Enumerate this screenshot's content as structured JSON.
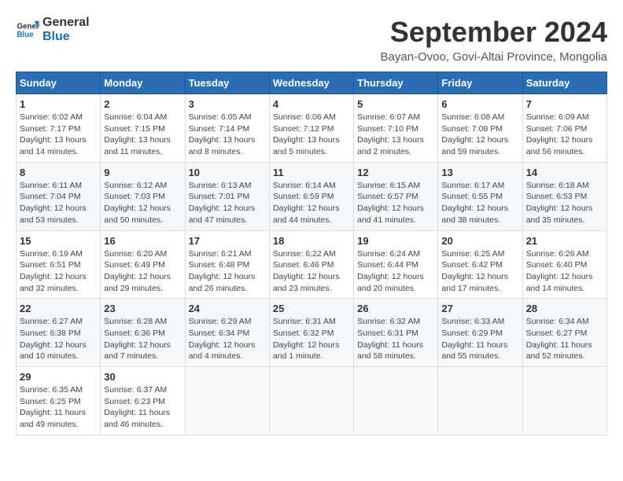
{
  "logo": {
    "line1": "General",
    "line2": "Blue"
  },
  "title": "September 2024",
  "subtitle": "Bayan-Ovoo, Govi-Altai Province, Mongolia",
  "weekdays": [
    "Sunday",
    "Monday",
    "Tuesday",
    "Wednesday",
    "Thursday",
    "Friday",
    "Saturday"
  ],
  "weeks": [
    [
      {
        "day": "1",
        "sunrise": "6:02 AM",
        "sunset": "7:17 PM",
        "daylight": "13 hours and 14 minutes."
      },
      {
        "day": "2",
        "sunrise": "6:04 AM",
        "sunset": "7:15 PM",
        "daylight": "13 hours and 11 minutes."
      },
      {
        "day": "3",
        "sunrise": "6:05 AM",
        "sunset": "7:14 PM",
        "daylight": "13 hours and 8 minutes."
      },
      {
        "day": "4",
        "sunrise": "6:06 AM",
        "sunset": "7:12 PM",
        "daylight": "13 hours and 5 minutes."
      },
      {
        "day": "5",
        "sunrise": "6:07 AM",
        "sunset": "7:10 PM",
        "daylight": "13 hours and 2 minutes."
      },
      {
        "day": "6",
        "sunrise": "6:08 AM",
        "sunset": "7:08 PM",
        "daylight": "12 hours and 59 minutes."
      },
      {
        "day": "7",
        "sunrise": "6:09 AM",
        "sunset": "7:06 PM",
        "daylight": "12 hours and 56 minutes."
      }
    ],
    [
      {
        "day": "8",
        "sunrise": "6:11 AM",
        "sunset": "7:04 PM",
        "daylight": "12 hours and 53 minutes."
      },
      {
        "day": "9",
        "sunrise": "6:12 AM",
        "sunset": "7:03 PM",
        "daylight": "12 hours and 50 minutes."
      },
      {
        "day": "10",
        "sunrise": "6:13 AM",
        "sunset": "7:01 PM",
        "daylight": "12 hours and 47 minutes."
      },
      {
        "day": "11",
        "sunrise": "6:14 AM",
        "sunset": "6:59 PM",
        "daylight": "12 hours and 44 minutes."
      },
      {
        "day": "12",
        "sunrise": "6:15 AM",
        "sunset": "6:57 PM",
        "daylight": "12 hours and 41 minutes."
      },
      {
        "day": "13",
        "sunrise": "6:17 AM",
        "sunset": "6:55 PM",
        "daylight": "12 hours and 38 minutes."
      },
      {
        "day": "14",
        "sunrise": "6:18 AM",
        "sunset": "6:53 PM",
        "daylight": "12 hours and 35 minutes."
      }
    ],
    [
      {
        "day": "15",
        "sunrise": "6:19 AM",
        "sunset": "6:51 PM",
        "daylight": "12 hours and 32 minutes."
      },
      {
        "day": "16",
        "sunrise": "6:20 AM",
        "sunset": "6:49 PM",
        "daylight": "12 hours and 29 minutes."
      },
      {
        "day": "17",
        "sunrise": "6:21 AM",
        "sunset": "6:48 PM",
        "daylight": "12 hours and 26 minutes."
      },
      {
        "day": "18",
        "sunrise": "6:22 AM",
        "sunset": "6:46 PM",
        "daylight": "12 hours and 23 minutes."
      },
      {
        "day": "19",
        "sunrise": "6:24 AM",
        "sunset": "6:44 PM",
        "daylight": "12 hours and 20 minutes."
      },
      {
        "day": "20",
        "sunrise": "6:25 AM",
        "sunset": "6:42 PM",
        "daylight": "12 hours and 17 minutes."
      },
      {
        "day": "21",
        "sunrise": "6:26 AM",
        "sunset": "6:40 PM",
        "daylight": "12 hours and 14 minutes."
      }
    ],
    [
      {
        "day": "22",
        "sunrise": "6:27 AM",
        "sunset": "6:38 PM",
        "daylight": "12 hours and 10 minutes."
      },
      {
        "day": "23",
        "sunrise": "6:28 AM",
        "sunset": "6:36 PM",
        "daylight": "12 hours and 7 minutes."
      },
      {
        "day": "24",
        "sunrise": "6:29 AM",
        "sunset": "6:34 PM",
        "daylight": "12 hours and 4 minutes."
      },
      {
        "day": "25",
        "sunrise": "6:31 AM",
        "sunset": "6:32 PM",
        "daylight": "12 hours and 1 minute."
      },
      {
        "day": "26",
        "sunrise": "6:32 AM",
        "sunset": "6:31 PM",
        "daylight": "11 hours and 58 minutes."
      },
      {
        "day": "27",
        "sunrise": "6:33 AM",
        "sunset": "6:29 PM",
        "daylight": "11 hours and 55 minutes."
      },
      {
        "day": "28",
        "sunrise": "6:34 AM",
        "sunset": "6:27 PM",
        "daylight": "11 hours and 52 minutes."
      }
    ],
    [
      {
        "day": "29",
        "sunrise": "6:35 AM",
        "sunset": "6:25 PM",
        "daylight": "11 hours and 49 minutes."
      },
      {
        "day": "30",
        "sunrise": "6:37 AM",
        "sunset": "6:23 PM",
        "daylight": "11 hours and 46 minutes."
      },
      null,
      null,
      null,
      null,
      null
    ]
  ]
}
